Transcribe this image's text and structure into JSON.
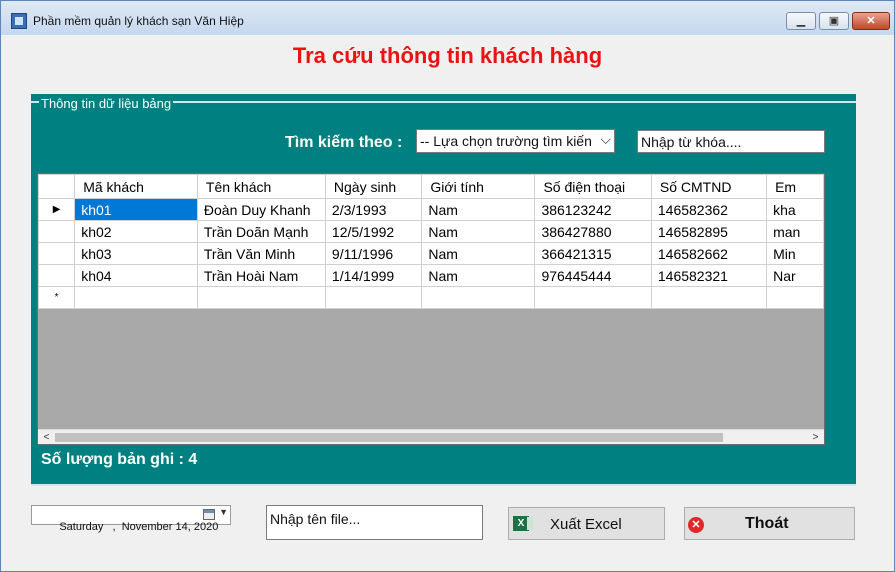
{
  "window": {
    "title": "Phần mềm quản lý khách sạn Văn Hiệp"
  },
  "page_title": "Tra cứu thông tin khách hàng",
  "group_legend": "Thông tin dữ liệu  bảng",
  "search": {
    "label": "Tìm kiếm theo :",
    "field_selected": "-- Lựa chọn trường tìm kiến",
    "keyword_value": "Nhập từ khóa...."
  },
  "grid": {
    "columns": [
      "Mã khách",
      "Tên khách",
      "Ngày sinh",
      "Giới tính",
      "Số điện thoại",
      "Số CMTND",
      "Em"
    ],
    "rows": [
      [
        "kh01",
        "Đoàn Duy Khanh",
        "2/3/1993",
        "Nam",
        "386123242",
        "146582362",
        "kha"
      ],
      [
        "kh02",
        "Trần Doãn Mạnh",
        "12/5/1992",
        "Nam",
        "386427880",
        "146582895",
        "man"
      ],
      [
        "kh03",
        "Trần Văn Minh",
        "9/11/1996",
        "Nam",
        "366421315",
        "146582662",
        "Min"
      ],
      [
        "kh04",
        "Trần Hoài Nam",
        "1/14/1999",
        "Nam",
        "976445444",
        "146582321",
        "Nar"
      ]
    ],
    "current_row_marker": "▶",
    "new_row_marker": "*"
  },
  "record_count": "Số lượng bản ghi : 4",
  "date_picker": {
    "value": "Saturday   ,  November 14, 2020"
  },
  "file_name": {
    "value": "Nhập tên file..."
  },
  "buttons": {
    "export": "Xuất Excel",
    "exit": "Thoát"
  },
  "colors": {
    "panel": "#008080",
    "title": "#ee1111",
    "selection": "#0078d7"
  }
}
